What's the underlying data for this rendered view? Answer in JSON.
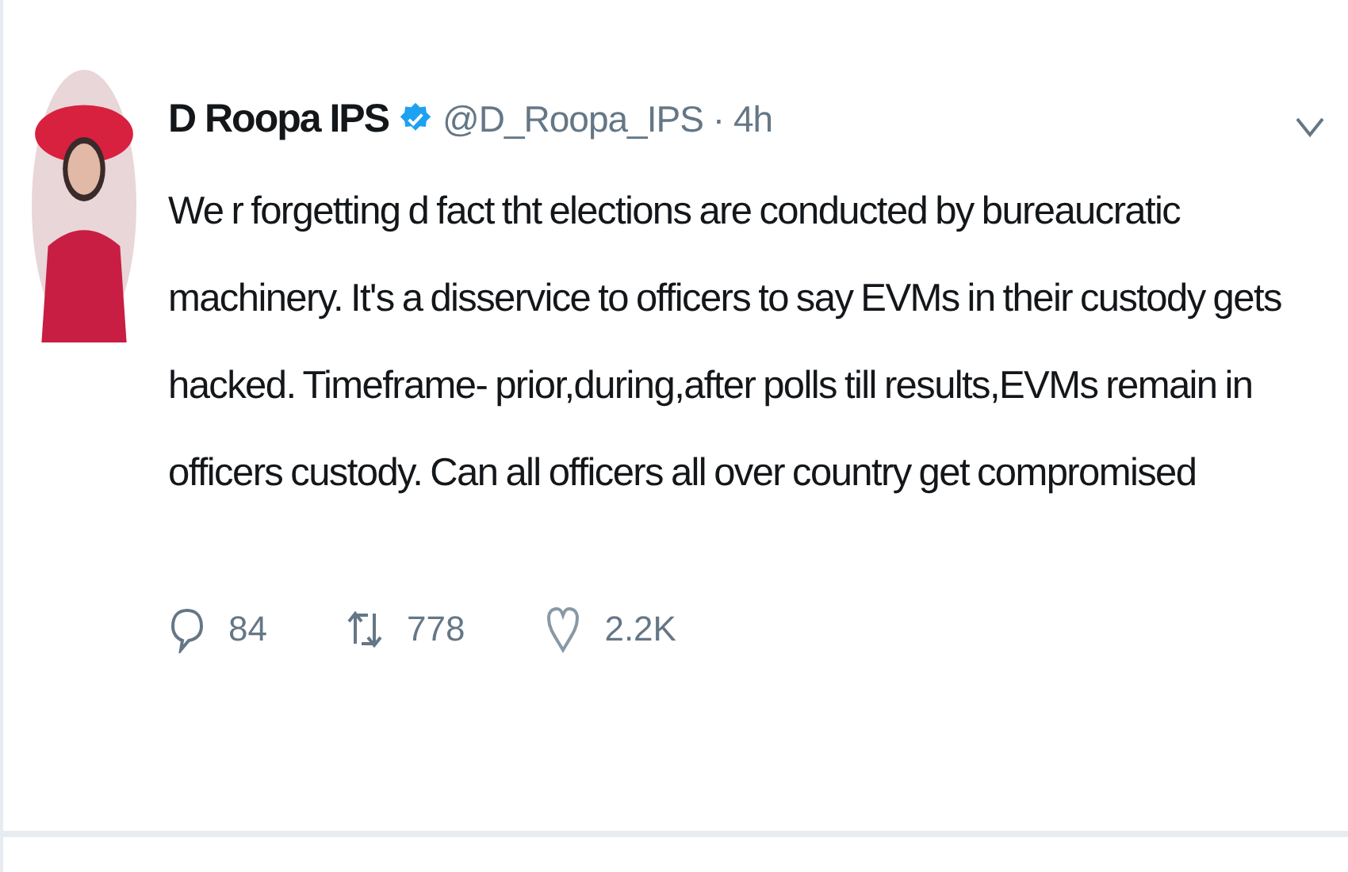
{
  "tweet": {
    "author": {
      "name": "D Roopa IPS",
      "verified": true,
      "handle": "@D_Roopa_IPS",
      "time": "· 4h"
    },
    "text": "We r forgetting d fact tht elections are conducted by bureaucratic machinery. It's a disservice to officers to say EVMs in their custody gets hacked. Timeframe- prior,during,after polls till results,EVMs remain in officers custody. Can all officers all over country get compromised",
    "actions": [
      {
        "kind": "reply",
        "count": "84"
      },
      {
        "kind": "retweet",
        "count": "778"
      },
      {
        "kind": "like",
        "count": "2.2K"
      }
    ]
  }
}
